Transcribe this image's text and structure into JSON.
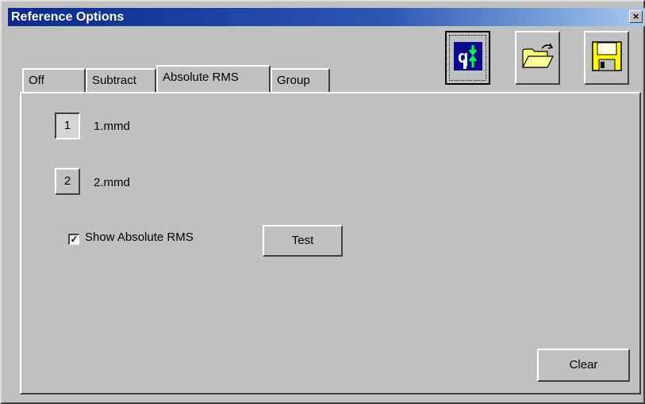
{
  "window": {
    "title": "Reference Options",
    "close_label": "×"
  },
  "toolbar": {
    "buttons": [
      {
        "name": "reference-tool-button",
        "icon": "reference-arrows-icon"
      },
      {
        "name": "open-folder-button",
        "icon": "open-folder-icon"
      },
      {
        "name": "save-button",
        "icon": "floppy-disk-icon"
      }
    ]
  },
  "tabs": [
    {
      "label": "Off"
    },
    {
      "label": "Subtract"
    },
    {
      "label": "Absolute RMS",
      "active": true
    },
    {
      "label": "Group"
    }
  ],
  "panel": {
    "slot1": {
      "number": "1",
      "file": "1.mmd",
      "pressed": true
    },
    "slot2": {
      "number": "2",
      "file": "2.mmd",
      "pressed": false
    },
    "show_rms": {
      "label": "Show Absolute RMS",
      "checked": true,
      "check_glyph": "✓"
    },
    "test_label": "Test",
    "clear_label": "Clear"
  },
  "colors": {
    "face": "#c0c0c0",
    "title_start": "#0a2a8c",
    "title_end": "#a6caf0",
    "tool_icon_bg": "#0a0a8c",
    "arrow_green": "#00ff40",
    "folder_yellow": "#ffff80",
    "floppy_yellow": "#ffff00"
  }
}
